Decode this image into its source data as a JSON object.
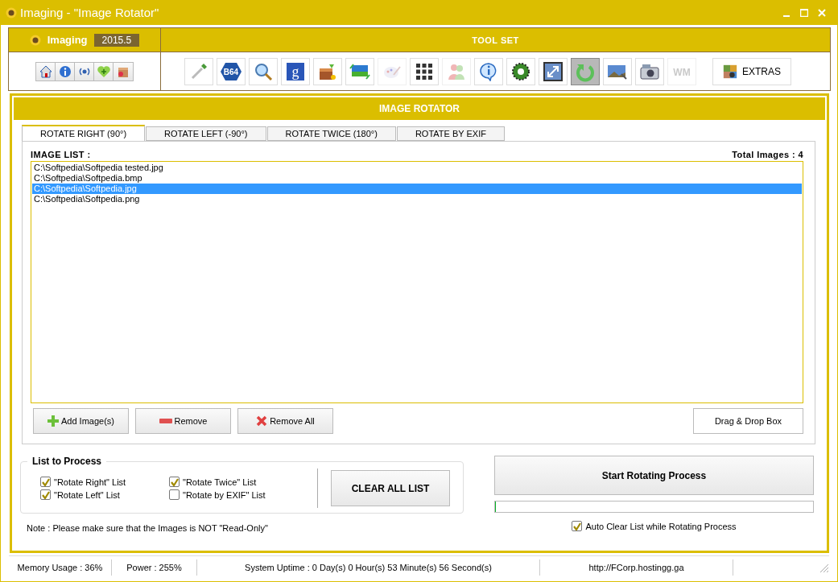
{
  "window": {
    "title": "Imaging - \"Image Rotator\""
  },
  "app_header": {
    "name": "Imaging",
    "version": "2015.5",
    "toolset_title": "TOOL SET"
  },
  "quick_buttons": [
    {
      "kind": "home"
    },
    {
      "kind": "info"
    },
    {
      "kind": "signal"
    },
    {
      "kind": "heart"
    },
    {
      "kind": "box"
    }
  ],
  "tools": [
    {
      "kind": "dropper",
      "selected": false,
      "disabled": false
    },
    {
      "kind": "b64",
      "label": "B64",
      "selected": false,
      "disabled": false
    },
    {
      "kind": "magnifier",
      "selected": false,
      "disabled": false
    },
    {
      "kind": "g",
      "label": "g",
      "selected": false,
      "disabled": false
    },
    {
      "kind": "package",
      "selected": false,
      "disabled": false
    },
    {
      "kind": "screen",
      "selected": false,
      "disabled": false
    },
    {
      "kind": "palette",
      "selected": false,
      "disabled": true
    },
    {
      "kind": "grid",
      "selected": false,
      "disabled": false
    },
    {
      "kind": "people",
      "selected": false,
      "disabled": true
    },
    {
      "kind": "info",
      "selected": false,
      "disabled": false
    },
    {
      "kind": "gear",
      "selected": false,
      "disabled": false
    },
    {
      "kind": "resize",
      "selected": false,
      "disabled": false
    },
    {
      "kind": "rotate",
      "selected": true,
      "disabled": false
    },
    {
      "kind": "photo",
      "selected": false,
      "disabled": false
    },
    {
      "kind": "camera",
      "selected": false,
      "disabled": false
    },
    {
      "kind": "wm",
      "label": "WM",
      "selected": false,
      "disabled": true
    }
  ],
  "extras_button": "EXTRAS",
  "panel_title": "IMAGE ROTATOR",
  "tabs": [
    {
      "label": "ROTATE RIGHT (90°)",
      "selected": true
    },
    {
      "label": "ROTATE LEFT (-90°)",
      "selected": false
    },
    {
      "label": "ROTATE TWICE (180°)",
      "selected": false
    },
    {
      "label": "ROTATE BY EXIF",
      "selected": false
    }
  ],
  "image_list": {
    "label": "IMAGE LIST :",
    "total": "Total Images : 4",
    "items": [
      {
        "path": "C:\\Softpedia\\Softpedia tested.jpg",
        "selected": false
      },
      {
        "path": "C:\\Softpedia\\Softpedia.bmp",
        "selected": false
      },
      {
        "path": "C:\\Softpedia\\Softpedia.jpg",
        "selected": true
      },
      {
        "path": "C:\\Softpedia\\Softpedia.png",
        "selected": false
      }
    ]
  },
  "list_buttons": [
    {
      "kind": "add",
      "label": "Add Image(s)"
    },
    {
      "kind": "remove",
      "label": "Remove"
    },
    {
      "kind": "remove_all",
      "label": "Remove All"
    }
  ],
  "drag_drop_button": "Drag & Drop Box",
  "list_to_process": {
    "title": "List to Process",
    "options": [
      {
        "label": "\"Rotate Right\" List",
        "checked": true
      },
      {
        "label": "\"Rotate Left\" List",
        "checked": true
      },
      {
        "label": "\"Rotate Twice\" List",
        "checked": true
      },
      {
        "label": "\"Rotate by EXIF\" List",
        "checked": false
      }
    ],
    "clear_button": "CLEAR ALL LIST"
  },
  "note": "Note : Please make sure that the Images is NOT \"Read-Only\"",
  "start_button": "Start Rotating Process",
  "progress": {
    "level": 0
  },
  "auto_clear": {
    "label": "Auto Clear List while Rotating Process",
    "checked": true
  },
  "status_bar": [
    "Memory Usage : 36%",
    "Power : 255%",
    "System Uptime : 0 Day(s) 0 Hour(s) 53 Minute(s) 56 Second(s)",
    "http://FCorp.hostingg.ga"
  ]
}
